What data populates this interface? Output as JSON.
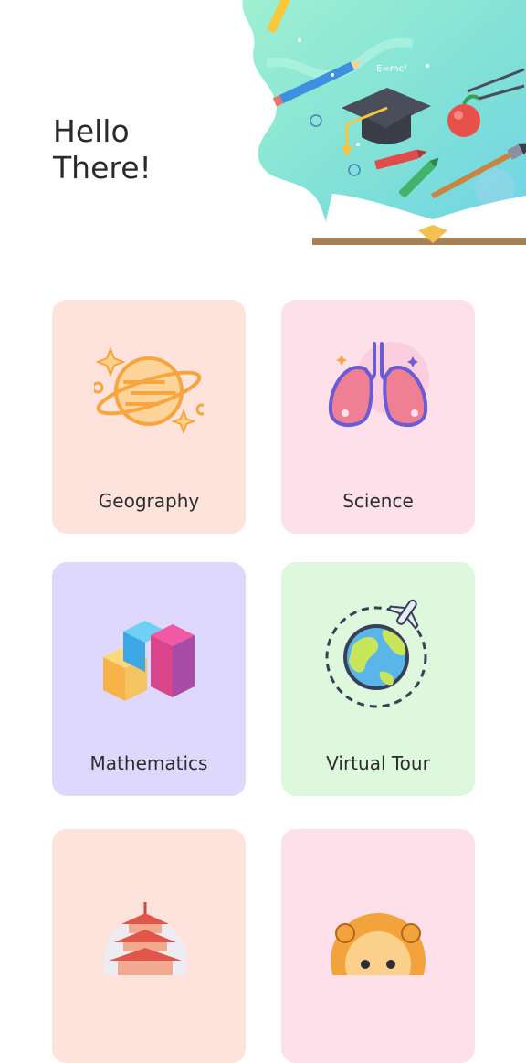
{
  "greeting": {
    "line1": "Hello",
    "line2": "There!"
  },
  "hero": {
    "formula": "E=mc²",
    "icon": "education-illustration"
  },
  "categories": [
    {
      "label": "Geography",
      "icon": "planet-icon",
      "bg": "#fde3db"
    },
    {
      "label": "Science",
      "icon": "lungs-icon",
      "bg": "#fde0ea"
    },
    {
      "label": "Mathematics",
      "icon": "cubes-icon",
      "bg": "#ddd8fc"
    },
    {
      "label": "Virtual Tour",
      "icon": "globe-plane-icon",
      "bg": "#def8de"
    },
    {
      "label": "",
      "icon": "pagoda-icon",
      "bg": "#fde3db"
    },
    {
      "label": "",
      "icon": "lion-icon",
      "bg": "#fde0ea"
    }
  ]
}
